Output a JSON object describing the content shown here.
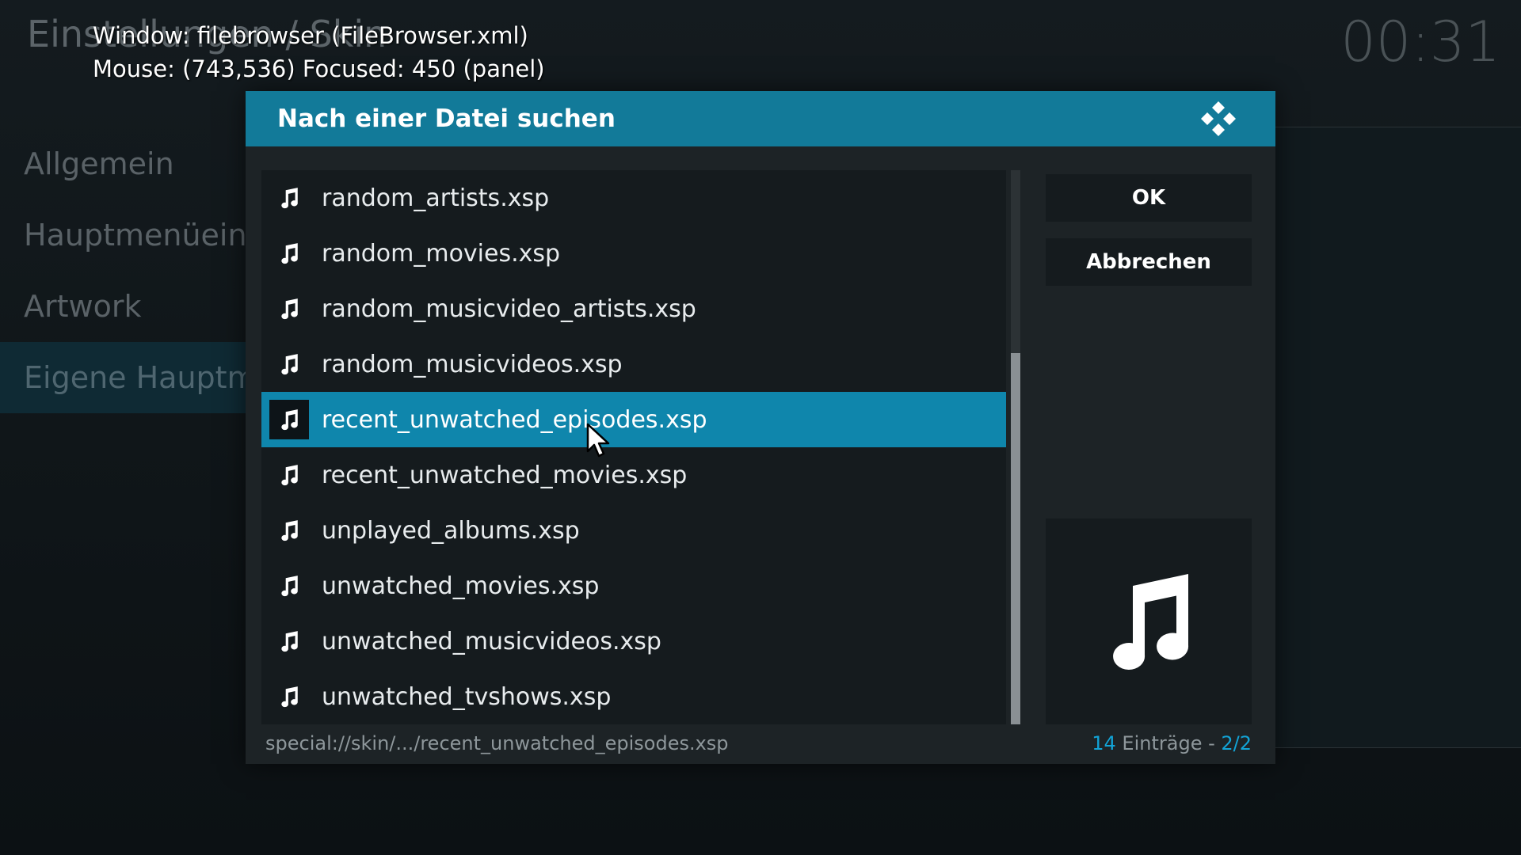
{
  "background": {
    "title": "Einstellungen / Skin",
    "clock": "00:31",
    "menu": [
      {
        "label": "Allgemein",
        "active": false
      },
      {
        "label": "Hauptmenüeinträge",
        "active": false
      },
      {
        "label": "Artwork",
        "active": false
      },
      {
        "label": "Eigene Hauptmenüeinträge",
        "active": true
      }
    ]
  },
  "debug": {
    "window": "Window: filebrowser (FileBrowser.xml)",
    "mouse": "Mouse: (743,536)  Focused: 450 (panel)"
  },
  "dialog": {
    "title": "Nach einer Datei suchen",
    "logo_icon": "kodi-logo-icon",
    "files": [
      {
        "name": "random_artists.xsp",
        "icon": "music-note-icon"
      },
      {
        "name": "random_movies.xsp",
        "icon": "music-note-icon"
      },
      {
        "name": "random_musicvideo_artists.xsp",
        "icon": "music-note-icon"
      },
      {
        "name": "random_musicvideos.xsp",
        "icon": "music-note-icon"
      },
      {
        "name": "recent_unwatched_episodes.xsp",
        "icon": "music-note-icon",
        "selected": true
      },
      {
        "name": "recent_unwatched_movies.xsp",
        "icon": "music-note-icon"
      },
      {
        "name": "unplayed_albums.xsp",
        "icon": "music-note-icon"
      },
      {
        "name": "unwatched_movies.xsp",
        "icon": "music-note-icon"
      },
      {
        "name": "unwatched_musicvideos.xsp",
        "icon": "music-note-icon"
      },
      {
        "name": "unwatched_tvshows.xsp",
        "icon": "music-note-icon"
      }
    ],
    "scroll": {
      "thumb_start": 0.33,
      "thumb_end": 1.0
    },
    "ok_label": "OK",
    "cancel_label": "Abbrechen",
    "preview_icon": "music-note-icon",
    "footer": {
      "path": "special://skin/.../recent_unwatched_episodes.xsp",
      "count": "14",
      "count_label": " Einträge - ",
      "page": "2/2"
    }
  },
  "colors": {
    "accent": "#12a3d6",
    "header": "#127a99",
    "selected": "#0f86ac"
  }
}
